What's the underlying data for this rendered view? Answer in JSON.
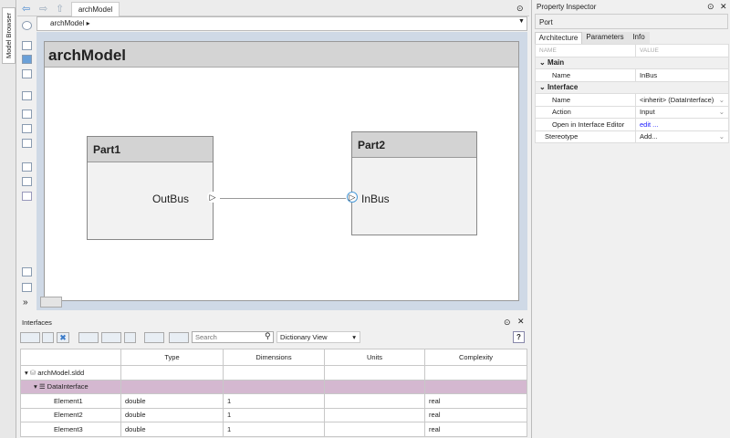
{
  "sidebar": {
    "model_browser": "Model Browser"
  },
  "nav": {
    "tab": "archModel",
    "breadcrumb": "archModel"
  },
  "diagram": {
    "title": "archModel",
    "parts": [
      {
        "name": "Part1",
        "port": "OutBus"
      },
      {
        "name": "Part2",
        "port": "InBus"
      }
    ]
  },
  "interfaces": {
    "title": "Interfaces",
    "search_placeholder": "Search",
    "view": "Dictionary View",
    "columns": [
      "",
      "Type",
      "Dimensions",
      "Units",
      "Complexity"
    ],
    "rows": [
      {
        "name": "archModel.sldd",
        "type": "",
        "dims": "",
        "units": "",
        "complexity": ""
      },
      {
        "name": "DataInterface",
        "type": "",
        "dims": "",
        "units": "",
        "complexity": ""
      },
      {
        "name": "Element1",
        "type": "double",
        "dims": "1",
        "units": "",
        "complexity": "real"
      },
      {
        "name": "Element2",
        "type": "double",
        "dims": "1",
        "units": "",
        "complexity": "real"
      },
      {
        "name": "Element3",
        "type": "double",
        "dims": "1",
        "units": "",
        "complexity": "real"
      }
    ],
    "highlight_color": "#d4b8d0"
  },
  "inspector": {
    "title": "Property Inspector",
    "subject": "Port",
    "tabs": [
      "Architecture",
      "Parameters",
      "Info"
    ],
    "col_name": "NAME",
    "col_value": "VALUE",
    "main": "Main",
    "main_name_label": "Name",
    "main_name_value": "InBus",
    "interface": "Interface",
    "if_name_label": "Name",
    "if_name_value": "<inherit> (DataInterface)",
    "action_label": "Action",
    "action_value": "Input",
    "open_label": "Open in Interface Editor",
    "open_value": "edit ...",
    "stereo_label": "Stereotype",
    "stereo_value": "Add..."
  }
}
